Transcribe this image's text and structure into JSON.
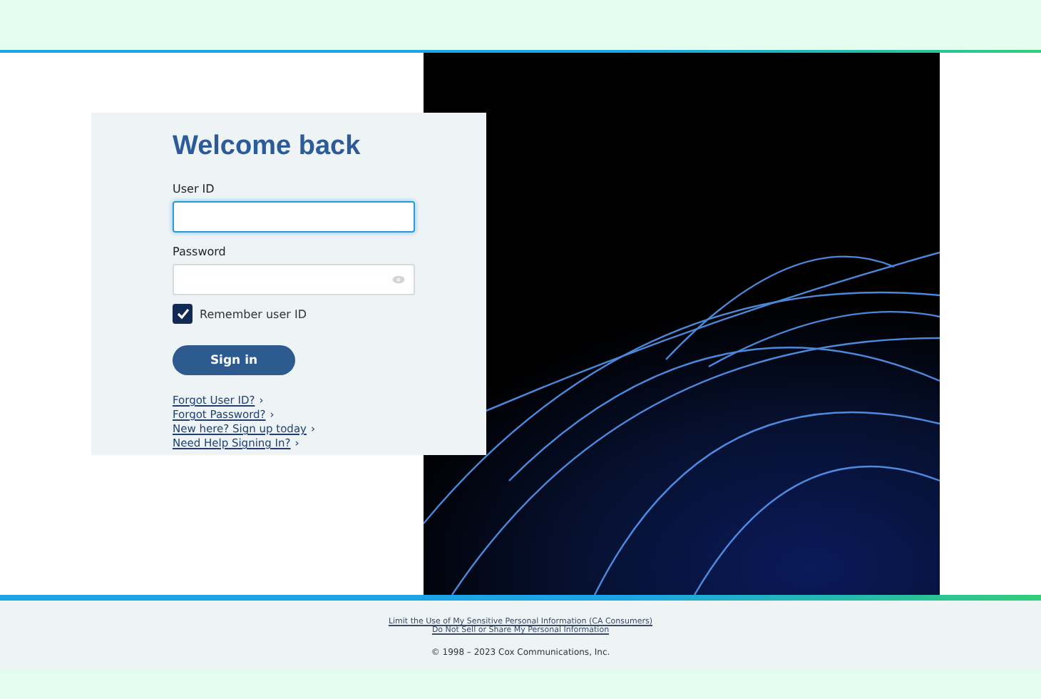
{
  "login": {
    "title": "Welcome back",
    "fields": [
      {
        "label": "User ID",
        "kind": "text",
        "focused": true
      },
      {
        "label": "Password",
        "kind": "password",
        "focused": false
      }
    ],
    "remember": {
      "label": "Remember user ID",
      "checked": true
    },
    "button": "Sign in",
    "links": [
      {
        "text": "Forgot User ID?",
        "chevron": "›"
      },
      {
        "text": "Forgot Password?",
        "chevron": "›"
      },
      {
        "text": "New here? Sign up today",
        "chevron": "›"
      },
      {
        "text": "Need Help Signing In?",
        "chevron": "›"
      }
    ]
  },
  "footer": {
    "links": [
      "Limit the Use of My Sensitive Personal Information (CA Consumers)",
      "Do Not Sell or Share My Personal Information"
    ],
    "copyright": "© 1998 – 2023 Cox Communications, Inc."
  }
}
